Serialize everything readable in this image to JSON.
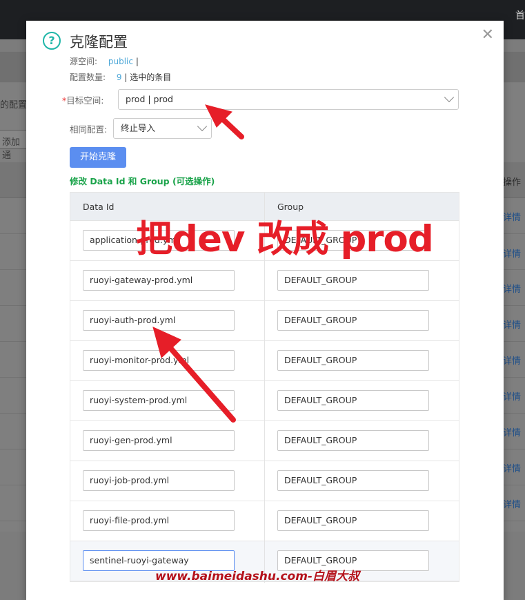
{
  "background": {
    "topbar_text": "首",
    "hint_text": "的配置。",
    "add_button": "添加通",
    "operation_header": "操作",
    "detail_link": "详情"
  },
  "dialog": {
    "title": "克隆配置",
    "source_label": "源空间:",
    "source_value": "public",
    "source_sep": "|",
    "count_label": "配置数量:",
    "count_value": "9",
    "count_suffix": "| 选中的条目",
    "target_label": "目标空间:",
    "target_required": "*",
    "target_value": "prod | prod",
    "same_config_label": "相同配置:",
    "same_config_value": "终止导入",
    "start_button": "开始克隆",
    "subtitle": "修改 Data Id 和 Group (可选操作)"
  },
  "table": {
    "headers": {
      "data_id": "Data Id",
      "group": "Group"
    },
    "rows": [
      {
        "data_id": "application-prod.yml",
        "group": "DEFAULT_GROUP"
      },
      {
        "data_id": "ruoyi-gateway-prod.yml",
        "group": "DEFAULT_GROUP"
      },
      {
        "data_id": "ruoyi-auth-prod.yml",
        "group": "DEFAULT_GROUP"
      },
      {
        "data_id": "ruoyi-monitor-prod.yml",
        "group": "DEFAULT_GROUP"
      },
      {
        "data_id": "ruoyi-system-prod.yml",
        "group": "DEFAULT_GROUP"
      },
      {
        "data_id": "ruoyi-gen-prod.yml",
        "group": "DEFAULT_GROUP"
      },
      {
        "data_id": "ruoyi-job-prod.yml",
        "group": "DEFAULT_GROUP"
      },
      {
        "data_id": "ruoyi-file-prod.yml",
        "group": "DEFAULT_GROUP"
      },
      {
        "data_id": "sentinel-ruoyi-gateway",
        "group": "DEFAULT_GROUP"
      }
    ]
  },
  "overlay": {
    "annotation": "把dev 改成 prod",
    "watermark": "www.baimeidashu.com-白眉大叔",
    "arrow_color": "#e61e28"
  },
  "colors": {
    "accent": "#5b8ef0",
    "subtitle_green": "#1aa34a",
    "link": "#4ea8d8",
    "help_icon": "#1fb6a8"
  }
}
